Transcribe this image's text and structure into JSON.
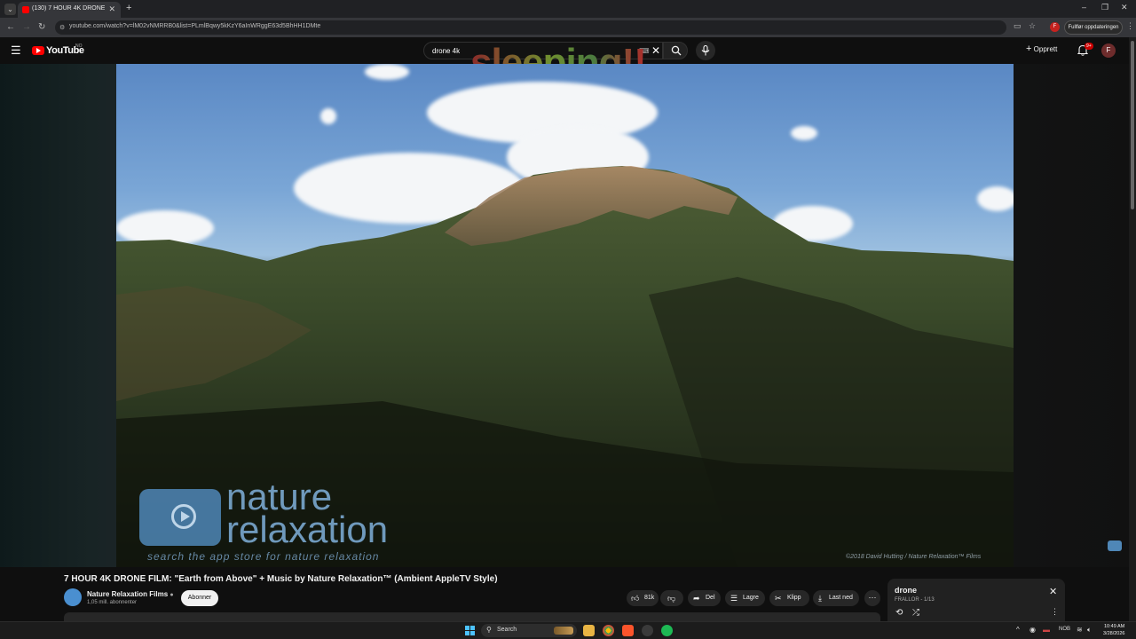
{
  "browser": {
    "tab_title": "(130) 7 HOUR 4K DRONE FILM",
    "url": "youtube.com/watch?v=lM02vNMRRB0&list=PLmlBqwy5kKzY6aInWRggE63d5BhHH1DMte",
    "update_button": "Fullfør oppdateringen",
    "profile_letter": "F",
    "tab_menu_icon": "chevron-down-icon",
    "new_tab_icon": "plus-icon"
  },
  "youtube": {
    "logo_text": "YouTube",
    "country_code": "NO",
    "search_value": "drone 4k",
    "create_label": "Opprett",
    "notification_count": "9+",
    "avatar_letter": "F"
  },
  "overlay": {
    "text": "sleeping!!"
  },
  "video": {
    "watermark_line1": "nature",
    "watermark_line2": "relaxation",
    "watermark_line3": "search the app store for nature relaxation",
    "copyright": "©2018 David Hutting / Nature Relaxation™ Films",
    "title": "7 HOUR 4K DRONE FILM: \"Earth from Above\" + Music by Nature Relaxation™ (Ambient AppleTV Style)"
  },
  "channel": {
    "name": "Nature Relaxation Films",
    "verified_icon": "verified-icon",
    "subscribers": "1,05 mill. abonnenter",
    "subscribe_label": "Abonner"
  },
  "actions": {
    "like_count": "81k",
    "share_label": "Del",
    "save_label": "Lagre",
    "clip_label": "Klipp",
    "download_label": "Last ned"
  },
  "playlist": {
    "title": "drone",
    "subtitle": "FRALLOR - 1/13"
  },
  "taskbar": {
    "search_label": "Search",
    "language": "NOB",
    "time": "10:49 AM",
    "date": "3/28/2026"
  },
  "colors": {
    "youtube_red": "#ff0000",
    "background": "#0f0f0f",
    "pill_bg": "#272727"
  }
}
